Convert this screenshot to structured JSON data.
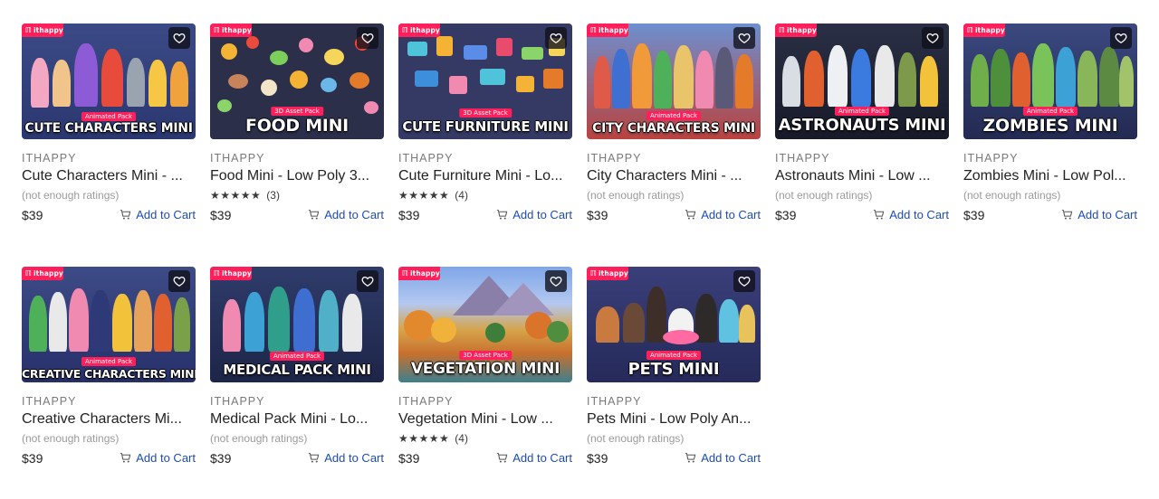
{
  "brand_label": "ithappy",
  "colors": {
    "brand": "#ff1f5b",
    "link": "#1e4bb8",
    "muted": "#9a9a9a"
  },
  "icons": {
    "favorite": "heart-icon",
    "cart": "cart-icon",
    "stars": "star-icon"
  },
  "products": [
    {
      "pill": "Animated Pack",
      "banner": "CUTE CHARACTERS MINI",
      "publisher": "ITHAPPY",
      "name": "Cute Characters Mini - ...",
      "rating": "(not enough ratings)",
      "stars": "",
      "count": "",
      "price": "$39",
      "cart": "Add to Cart"
    },
    {
      "pill": "3D Asset Pack",
      "banner": "FOOD MINI",
      "publisher": "ITHAPPY",
      "name": "Food Mini - Low Poly 3...",
      "rating": "",
      "stars": "★★★★★",
      "count": "(3)",
      "price": "$39",
      "cart": "Add to Cart"
    },
    {
      "pill": "3D Asset Pack",
      "banner": "CUTE FURNITURE MINI",
      "publisher": "ITHAPPY",
      "name": "Cute Furniture Mini - Lo...",
      "rating": "",
      "stars": "★★★★★",
      "count": "(4)",
      "price": "$39",
      "cart": "Add to Cart"
    },
    {
      "pill": "Animated Pack",
      "banner": "CITY CHARACTERS MINI",
      "publisher": "ITHAPPY",
      "name": "City Characters Mini - ...",
      "rating": "(not enough ratings)",
      "stars": "",
      "count": "",
      "price": "$39",
      "cart": "Add to Cart"
    },
    {
      "pill": "Animated Pack",
      "banner": "ASTRONAUTS MINI",
      "publisher": "ITHAPPY",
      "name": "Astronauts Mini - Low ...",
      "rating": "(not enough ratings)",
      "stars": "",
      "count": "",
      "price": "$39",
      "cart": "Add to Cart"
    },
    {
      "pill": "Animated Pack",
      "banner": "ZOMBIES MINI",
      "publisher": "ITHAPPY",
      "name": "Zombies Mini - Low Pol...",
      "rating": "(not enough ratings)",
      "stars": "",
      "count": "",
      "price": "$39",
      "cart": "Add to Cart"
    },
    {
      "pill": "Animated Pack",
      "banner": "CREATIVE CHARACTERS MINI",
      "publisher": "ITHAPPY",
      "name": "Creative Characters Mi...",
      "rating": "(not enough ratings)",
      "stars": "",
      "count": "",
      "price": "$39",
      "cart": "Add to Cart"
    },
    {
      "pill": "Animated Pack",
      "banner": "MEDICAL PACK MINI",
      "publisher": "ITHAPPY",
      "name": "Medical Pack Mini - Lo...",
      "rating": "(not enough ratings)",
      "stars": "",
      "count": "",
      "price": "$39",
      "cart": "Add to Cart"
    },
    {
      "pill": "3D Asset Pack",
      "banner": "VEGETATION MINI",
      "publisher": "ITHAPPY",
      "name": "Vegetation Mini - Low ...",
      "rating": "",
      "stars": "★★★★★",
      "count": "(4)",
      "price": "$39",
      "cart": "Add to Cart"
    },
    {
      "pill": "Animated Pack",
      "banner": "PETS MINI",
      "publisher": "ITHAPPY",
      "name": "Pets Mini - Low Poly An...",
      "rating": "(not enough ratings)",
      "stars": "",
      "count": "",
      "price": "$39",
      "cart": "Add to Cart"
    }
  ]
}
